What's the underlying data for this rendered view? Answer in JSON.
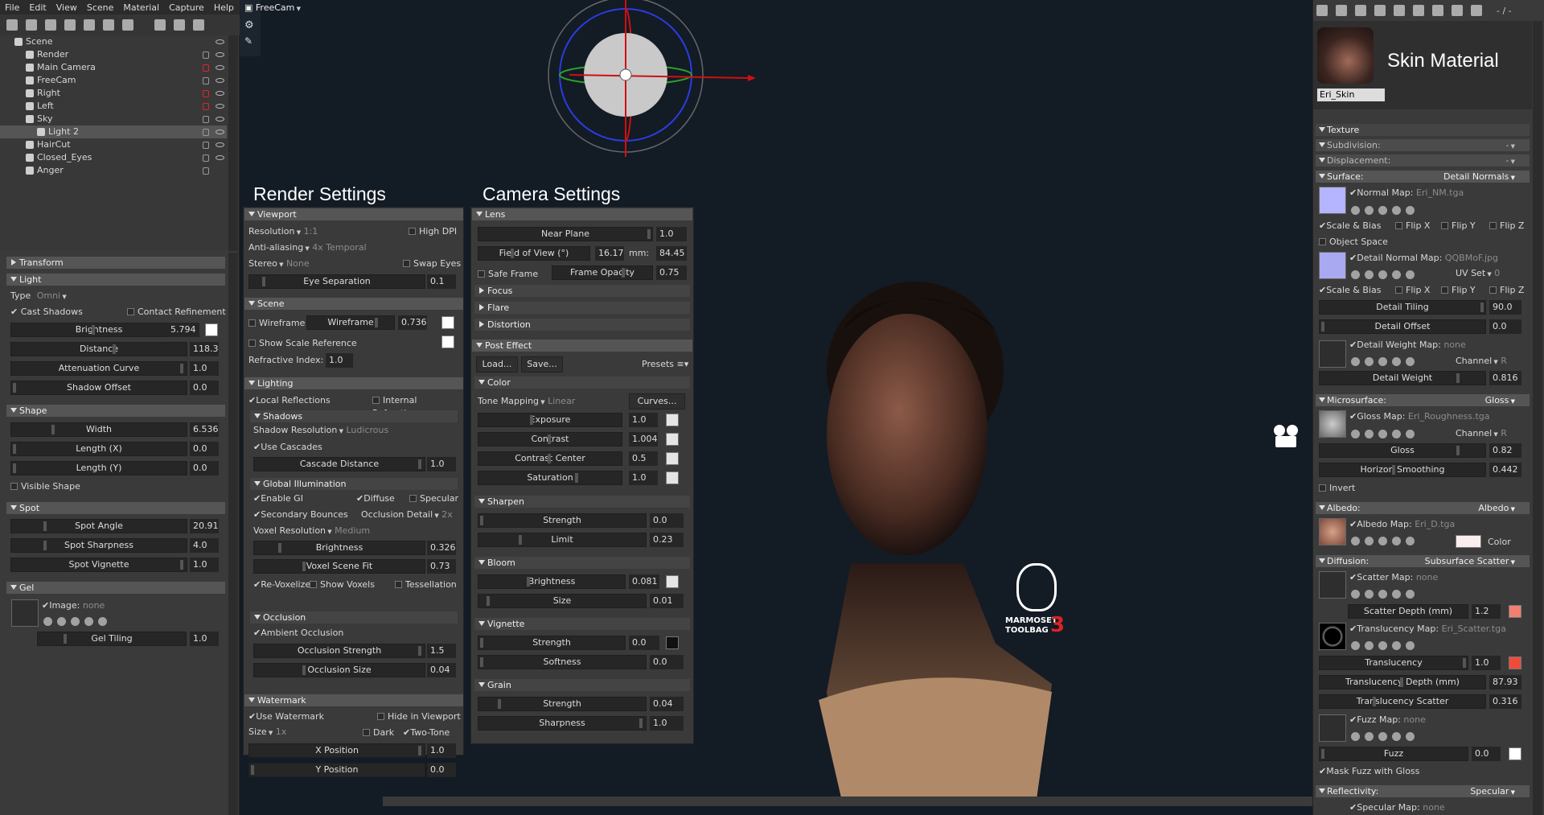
{
  "menu": [
    "File",
    "Edit",
    "View",
    "Scene",
    "Material",
    "Capture",
    "Help"
  ],
  "viewport": {
    "camera": "FreeCam"
  },
  "scene_tree": [
    {
      "name": "Scene",
      "indent": 0,
      "lock": "",
      "eye": true
    },
    {
      "name": "Render",
      "indent": 1,
      "lock": "gray",
      "eye": true
    },
    {
      "name": "Main Camera",
      "indent": 1,
      "lock": "red",
      "eye": true
    },
    {
      "name": "FreeCam",
      "indent": 1,
      "lock": "gray",
      "eye": true
    },
    {
      "name": "Right",
      "indent": 1,
      "lock": "red",
      "eye": true
    },
    {
      "name": "Left",
      "indent": 1,
      "lock": "red",
      "eye": true
    },
    {
      "name": "Sky",
      "indent": 1,
      "lock": "gray",
      "eye": true
    },
    {
      "name": "Light 2",
      "indent": 2,
      "lock": "gray",
      "eye": true,
      "selected": true
    },
    {
      "name": "HairCut",
      "indent": 1,
      "lock": "gray",
      "eye": true
    },
    {
      "name": "Closed_Eyes",
      "indent": 1,
      "lock": "gray",
      "eye": true
    },
    {
      "name": "Anger",
      "indent": 1,
      "lock": "gray",
      "eye": false
    }
  ],
  "left": {
    "transform": "Transform",
    "light": "Light",
    "type_label": "Type",
    "type_value": "Omni",
    "cast_shadows": "Cast Shadows",
    "contact_refinement": "Contact Refinement",
    "brightness_label": "Brightness",
    "brightness": "5.794",
    "distance_label": "Distance",
    "distance": "118.3",
    "atten_label": "Attenuation Curve",
    "atten": "1.0",
    "shadow_offset_label": "Shadow Offset",
    "shadow_offset": "0.0",
    "shape": "Shape",
    "width_label": "Width",
    "width": "6.536",
    "lengthx_label": "Length (X)",
    "lengthx": "0.0",
    "lengthy_label": "Length (Y)",
    "lengthy": "0.0",
    "visible_shape": "Visible Shape",
    "spot": "Spot",
    "spot_angle_label": "Spot Angle",
    "spot_angle": "20.91",
    "spot_sharp_label": "Spot Sharpness",
    "spot_sharp": "4.0",
    "spot_vig_label": "Spot Vignette",
    "spot_vig": "1.0",
    "gel": "Gel",
    "image_label": "Image:",
    "image_value": "none",
    "gel_tiling_label": "Gel Tiling",
    "gel_tiling": "1.0"
  },
  "render": {
    "title": "Render Settings",
    "viewport": "Viewport",
    "resolution_label": "Resolution",
    "resolution": "1:1",
    "high_dpi": "High DPI",
    "aa_label": "Anti-aliasing",
    "aa": "4x Temporal",
    "stereo_label": "Stereo",
    "stereo": "None",
    "swap_eyes": "Swap Eyes",
    "eye_sep_label": "Eye Separation",
    "eye_sep": "0.1",
    "scene": "Scene",
    "wireframe": "Wireframe",
    "wireframe_slider": "Wireframe",
    "wireframe_val": "0.736",
    "show_scale": "Show Scale Reference",
    "refractive_label": "Refractive Index:",
    "refractive": "1.0",
    "lighting": "Lighting",
    "local_refl": "Local Reflections",
    "internal_refr": "Internal Refraction",
    "shadows": "Shadows",
    "shadow_res_label": "Shadow Resolution",
    "shadow_res": "Ludicrous",
    "use_cascades": "Use Cascades",
    "cascade_label": "Cascade Distance",
    "cascade": "1.0",
    "gi": "Global Illumination",
    "enable_gi": "Enable GI",
    "diffuse": "Diffuse",
    "specular": "Specular",
    "secondary": "Secondary Bounces",
    "occ_detail_label": "Occlusion Detail",
    "occ_detail": "2x",
    "voxel_res_label": "Voxel Resolution",
    "voxel_res": "Medium",
    "gi_bright_label": "Brightness",
    "gi_bright": "0.326",
    "voxel_fit_label": "Voxel Scene Fit",
    "voxel_fit": "0.73",
    "revox": "Re-Voxelize",
    "show_voxels": "Show Voxels",
    "tess": "Tessellation",
    "occlusion": "Occlusion",
    "ambient_occ": "Ambient Occlusion",
    "occ_strength_label": "Occlusion Strength",
    "occ_strength": "1.5",
    "occ_size_label": "Occlusion Size",
    "occ_size": "0.04",
    "watermark": "Watermark",
    "use_wm": "Use Watermark",
    "hide_vp": "Hide in Viewport",
    "size_label": "Size",
    "size": "1x",
    "dark": "Dark",
    "two_tone": "Two-Tone",
    "xpos_label": "X Position",
    "xpos": "1.0",
    "ypos_label": "Y Position",
    "ypos": "0.0"
  },
  "camera": {
    "title": "Camera Settings",
    "lens": "Lens",
    "near_label": "Near Plane",
    "near": "1.0",
    "fov_label": "Field of View (°)",
    "fov": "16.17",
    "mm_label": "mm:",
    "mm": "84.45",
    "safe_frame": "Safe Frame",
    "frame_op_label": "Frame Opacity",
    "frame_op": "0.75",
    "focus": "Focus",
    "flare": "Flare",
    "distortion": "Distortion",
    "post": "Post Effect",
    "load": "Load...",
    "save": "Save...",
    "presets": "Presets",
    "color": "Color",
    "tone_label": "Tone Mapping",
    "tone": "Linear",
    "curves": "Curves...",
    "exposure_label": "Exposure",
    "exposure": "1.0",
    "contrast_label": "Contrast",
    "contrast": "1.004",
    "cc_label": "Contrast Center",
    "cc": "0.5",
    "sat_label": "Saturation",
    "sat": "1.0",
    "sharpen": "Sharpen",
    "sh_strength_label": "Strength",
    "sh_strength": "0.0",
    "limit_label": "Limit",
    "limit": "0.23",
    "bloom": "Bloom",
    "bl_bright_label": "Brightness",
    "bl_bright": "0.081",
    "bl_size_label": "Size",
    "bl_size": "0.01",
    "vignette": "Vignette",
    "vg_strength_label": "Strength",
    "vg_strength": "0.0",
    "vg_soft_label": "Softness",
    "vg_soft": "0.0",
    "grain": "Grain",
    "gr_strength_label": "Strength",
    "gr_strength": "0.04",
    "gr_sharp_label": "Sharpness",
    "gr_sharp": "1.0"
  },
  "material": {
    "title": "Skin Material",
    "name": "Eri_Skin",
    "page": "- / -",
    "texture": "Texture",
    "subdivision": "Subdivision:",
    "displacement": "Displacement:",
    "dash": "-",
    "surface": "Surface:",
    "surface_mode": "Detail Normals",
    "normal_map_label": "Normal Map:",
    "normal_map": "Eri_NM.tga",
    "scale_bias": "Scale & Bias",
    "flip_x": "Flip X",
    "flip_y": "Flip Y",
    "flip_z": "Flip Z",
    "object_space": "Object Space",
    "detail_nm_label": "Detail Normal Map:",
    "detail_nm": "QQBMoF.jpg",
    "uv_set_label": "UV Set",
    "uv_set": "0",
    "detail_tiling_label": "Detail Tiling",
    "detail_tiling": "90.0",
    "detail_offset_label": "Detail Offset",
    "detail_offset": "0.0",
    "detail_weight_map_label": "Detail Weight Map:",
    "detail_weight_map": "none",
    "channel_label": "Channel",
    "channel_r": "R",
    "detail_weight_label": "Detail Weight",
    "detail_weight": "0.816",
    "micro": "Microsurface:",
    "micro_mode": "Gloss",
    "gloss_map_label": "Gloss Map:",
    "gloss_map": "Eri_Roughness.tga",
    "gloss_label": "Gloss",
    "gloss": "0.82",
    "horizon_label": "Horizon Smoothing",
    "horizon": "0.442",
    "invert": "Invert",
    "albedo": "Albedo:",
    "albedo_mode": "Albedo",
    "albedo_map_label": "Albedo Map:",
    "albedo_map": "Eri_D.tga",
    "color_label": "Color",
    "diffusion": "Diffusion:",
    "diffusion_mode": "Subsurface Scatter",
    "scatter_map_label": "Scatter Map:",
    "scatter_map": "none",
    "scatter_depth_label": "Scatter Depth (mm)",
    "scatter_depth": "1.2",
    "transl_map_label": "Translucency Map:",
    "transl_map": "Eri_Scatter.tga",
    "transl_label": "Translucency",
    "transl": "1.0",
    "transl_depth_label": "Translucency Depth (mm)",
    "transl_depth": "87.93",
    "transl_scatter_label": "Translucency Scatter",
    "transl_scatter": "0.316",
    "fuzz_map_label": "Fuzz Map:",
    "fuzz_map": "none",
    "fuzz_label": "Fuzz",
    "fuzz": "0.0",
    "mask_fuzz": "Mask Fuzz with Gloss",
    "reflect": "Reflectivity:",
    "reflect_mode": "Specular",
    "spec_map_label": "Specular Map:",
    "spec_map": "none"
  },
  "logo": {
    "line1": "MARMOSET",
    "line2": "TOOLBAG",
    "num": "3"
  },
  "colors": {
    "bg": "#141c26",
    "panel": "#3a3a3a",
    "header": "#555555",
    "scatter": "#f08070",
    "transl": "#f04a3a"
  }
}
